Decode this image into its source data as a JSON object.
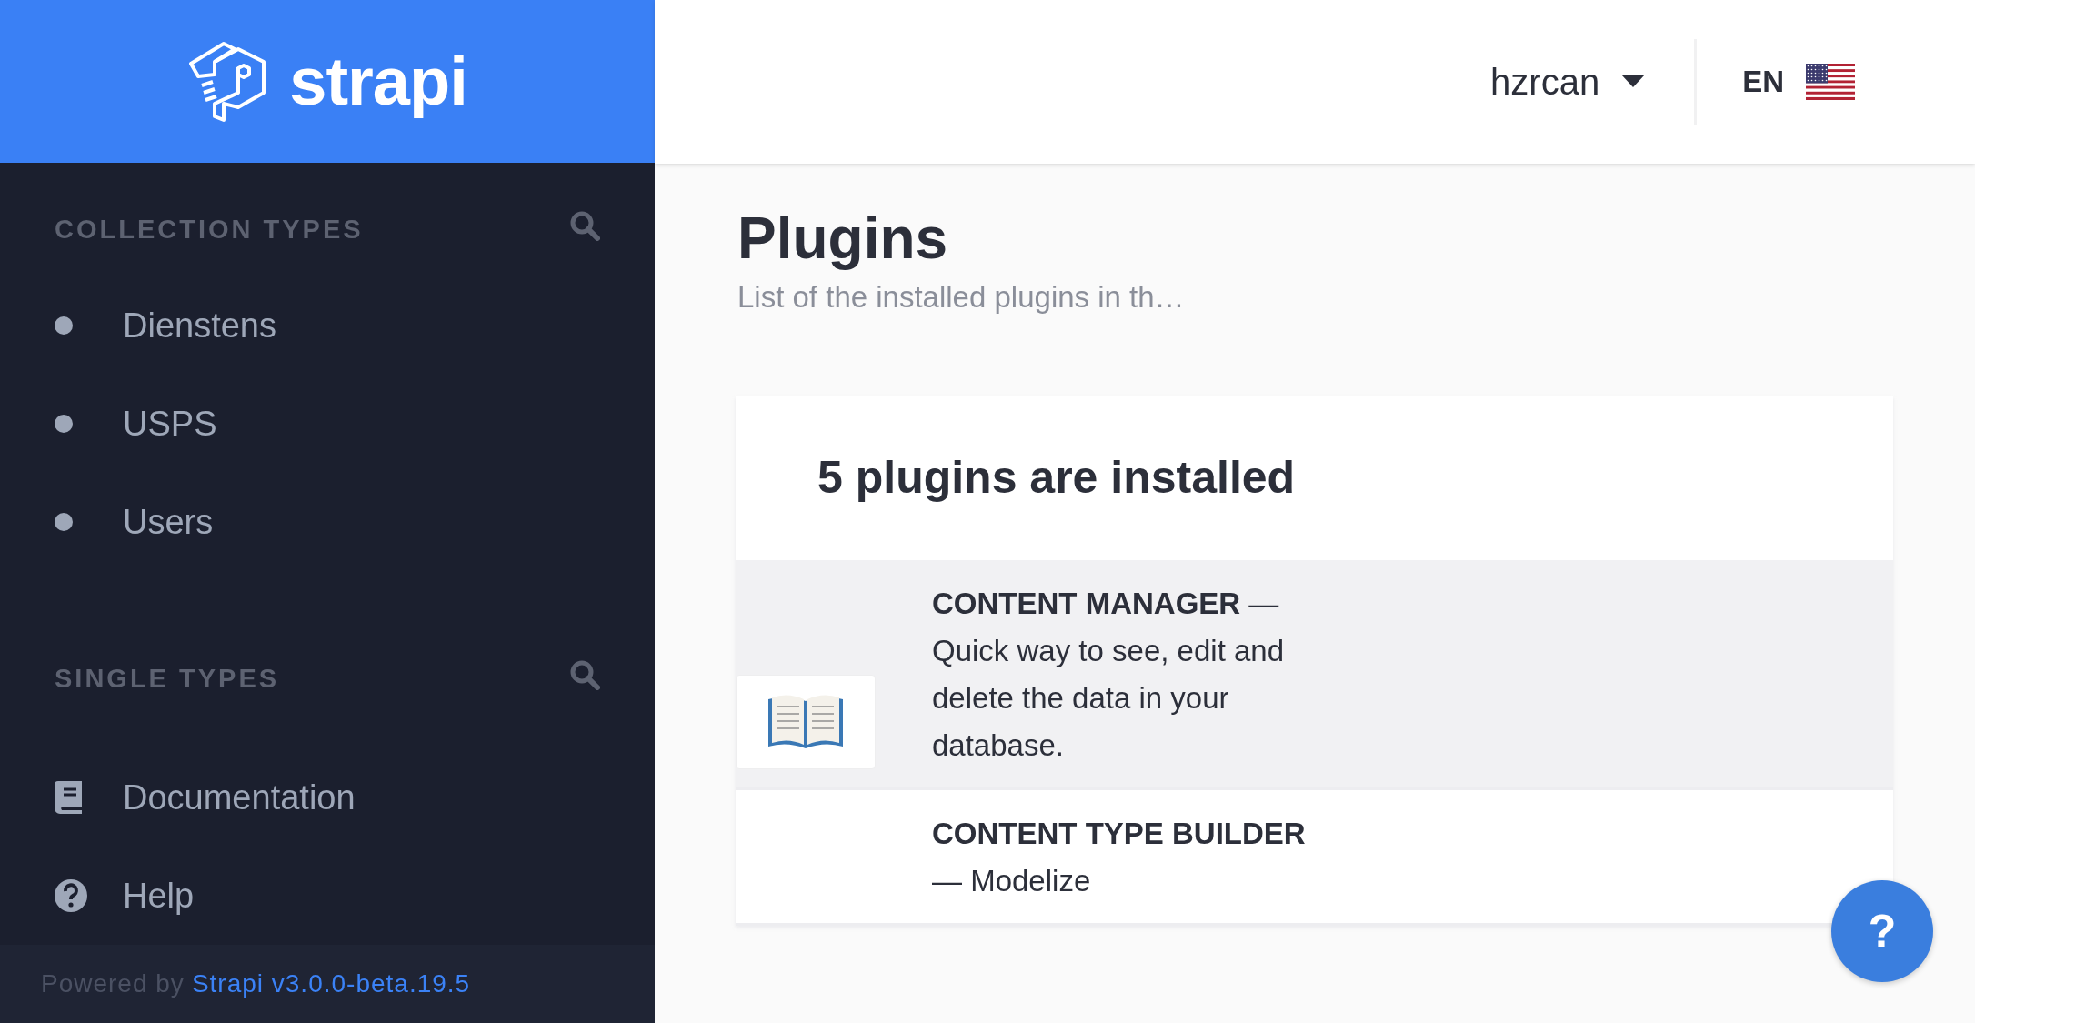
{
  "logo": {
    "text": "strapi"
  },
  "sidebar": {
    "sections": [
      {
        "title": "COLLECTION TYPES",
        "items": [
          {
            "label": "Dienstens"
          },
          {
            "label": "USPS"
          },
          {
            "label": "Users"
          }
        ]
      },
      {
        "title": "SINGLE TYPES"
      }
    ],
    "links": [
      {
        "kind": "book",
        "label": "Documentation"
      },
      {
        "kind": "help",
        "label": "Help"
      }
    ],
    "footer": {
      "prefix": "Powered by",
      "link": "Strapi v3.0.0-beta.19.5"
    }
  },
  "header": {
    "user": "hzrcan",
    "language": "EN"
  },
  "page": {
    "title": "Plugins",
    "subtitle": "List of the installed plugins in th…"
  },
  "card": {
    "heading": "5 plugins are installed",
    "plugins": [
      {
        "text": "**CONTENT MANAGER** — Quick way to see, edit and delete the data in your database.",
        "hovered": true,
        "icon_shown": true
      },
      {
        "text": "**CONTENT TYPE BUILDER** — Modelize",
        "hovered": false,
        "icon_shown": false
      }
    ]
  },
  "help_button": {
    "label": "?"
  }
}
